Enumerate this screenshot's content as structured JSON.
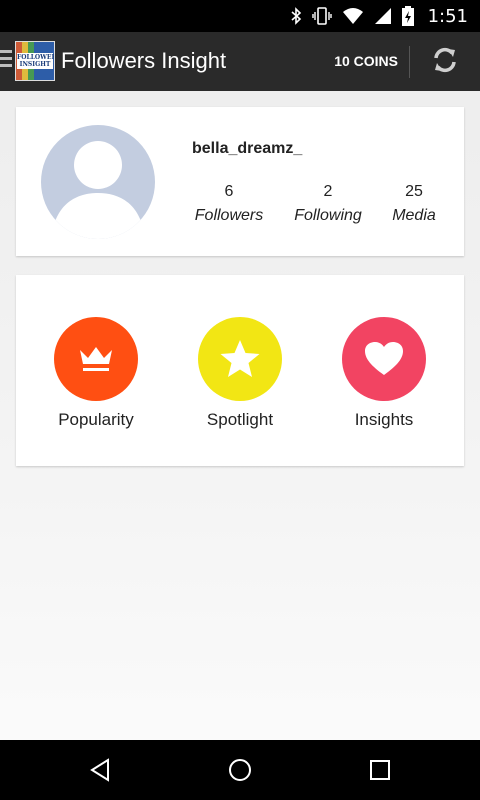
{
  "status_bar": {
    "time": "1:51",
    "icons": [
      "bluetooth-icon",
      "vibrate-icon",
      "wifi-icon",
      "signal-icon",
      "battery-charging-icon"
    ]
  },
  "app_bar": {
    "logo_text": "FOLLOWERS INSIGHT",
    "title": "Followers Insight",
    "coins_label": "10 COINS",
    "refresh_icon": "refresh-icon",
    "menu_icon": "menu-icon"
  },
  "profile": {
    "username": "bella_dreamz_",
    "avatar_icon": "default-avatar-icon",
    "stats": [
      {
        "value": "6",
        "label": "Followers"
      },
      {
        "value": "2",
        "label": "Following"
      },
      {
        "value": "25",
        "label": "Media"
      }
    ]
  },
  "features": [
    {
      "label": "Popularity",
      "icon": "crown-icon",
      "color": "#ff4f12"
    },
    {
      "label": "Spotlight",
      "icon": "star-icon",
      "color": "#f2e614"
    },
    {
      "label": "Insights",
      "icon": "heart-icon",
      "color": "#f24462"
    }
  ],
  "nav_bar": {
    "buttons": [
      "back-icon",
      "home-icon",
      "recents-icon"
    ]
  }
}
